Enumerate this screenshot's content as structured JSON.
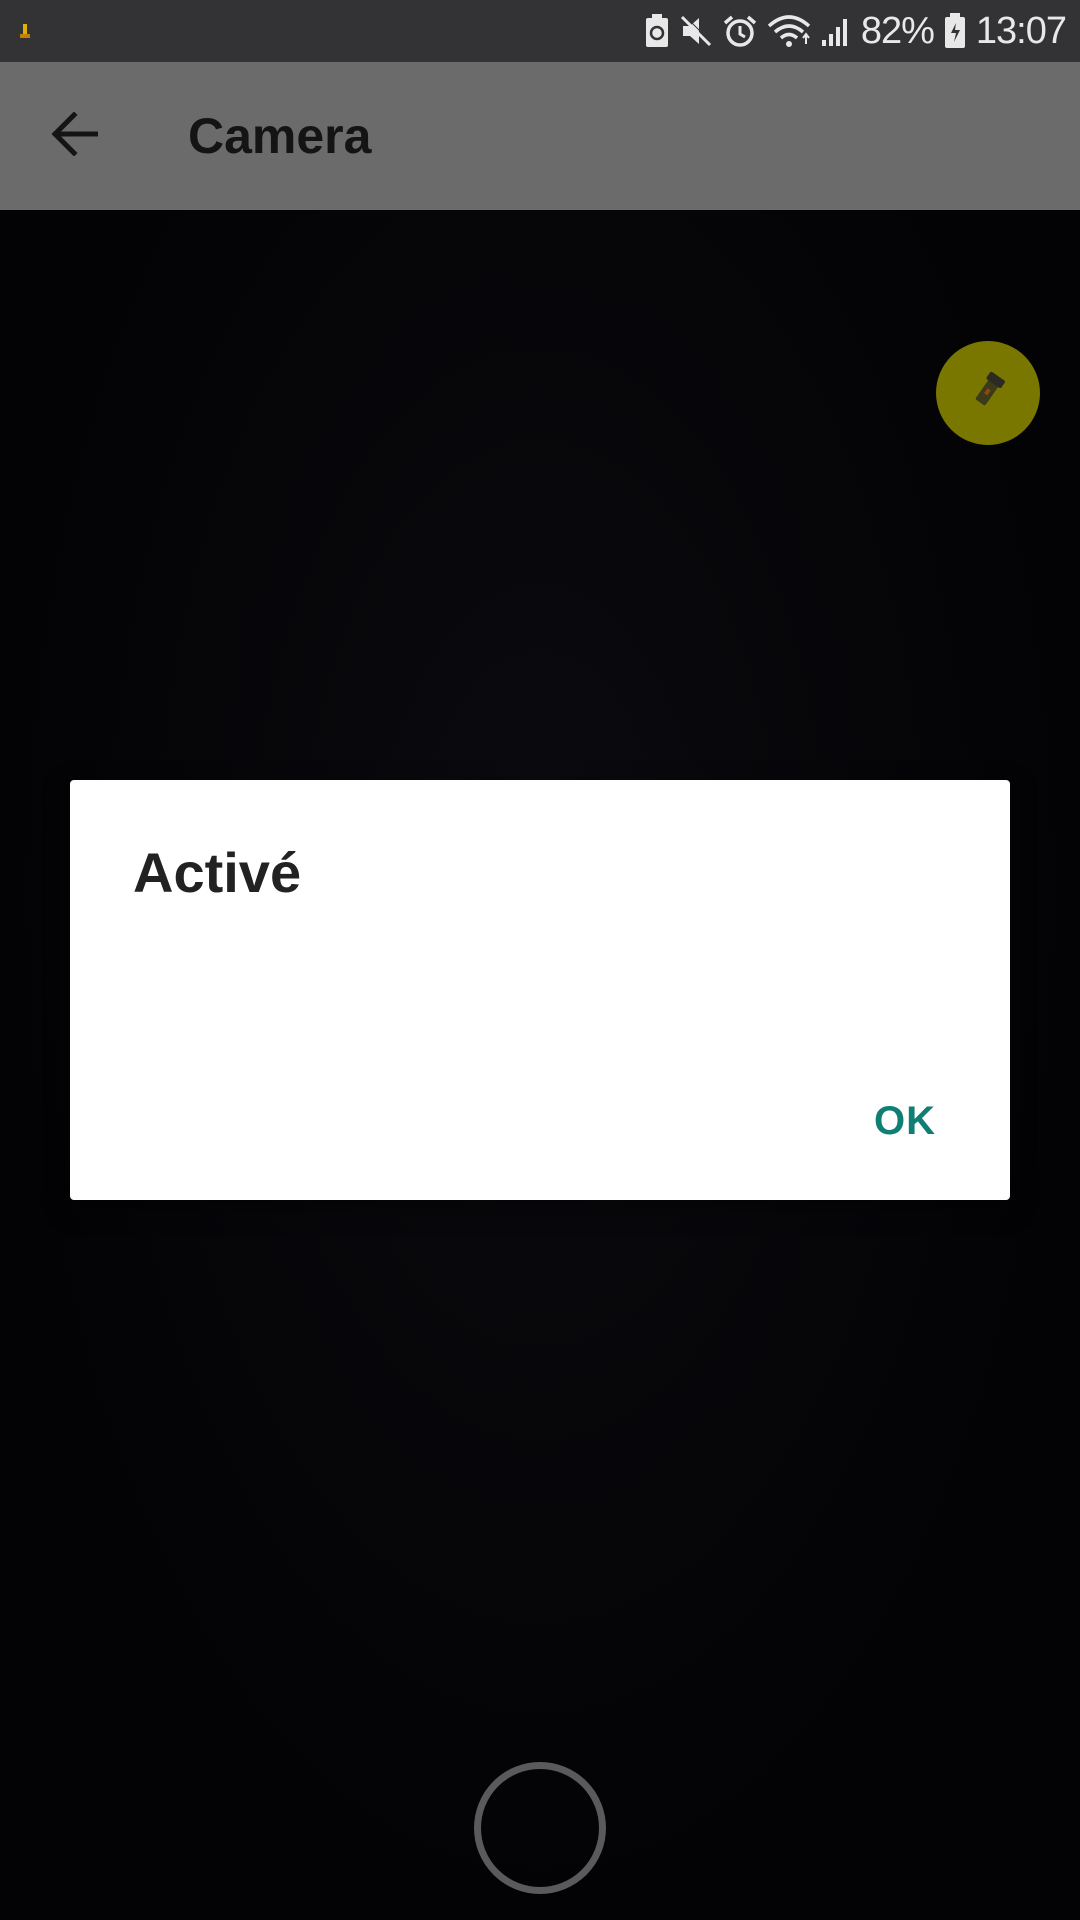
{
  "status_bar": {
    "battery_percent": "82%",
    "time": "13:07",
    "icons": [
      "notification-icon",
      "battery-saver-icon",
      "mute-icon",
      "alarm-icon",
      "wifi-icon",
      "signal-icon",
      "battery-icon"
    ]
  },
  "app_bar": {
    "title": "Camera",
    "back_icon": "arrow-back-icon"
  },
  "camera": {
    "flash_icon": "flashlight-icon",
    "flash_color": "#7a7700",
    "shutter_icon": "shutter-ring-icon"
  },
  "dialog": {
    "title": "Activé",
    "ok_label": "OK",
    "accent_color": "#0e7f72"
  }
}
